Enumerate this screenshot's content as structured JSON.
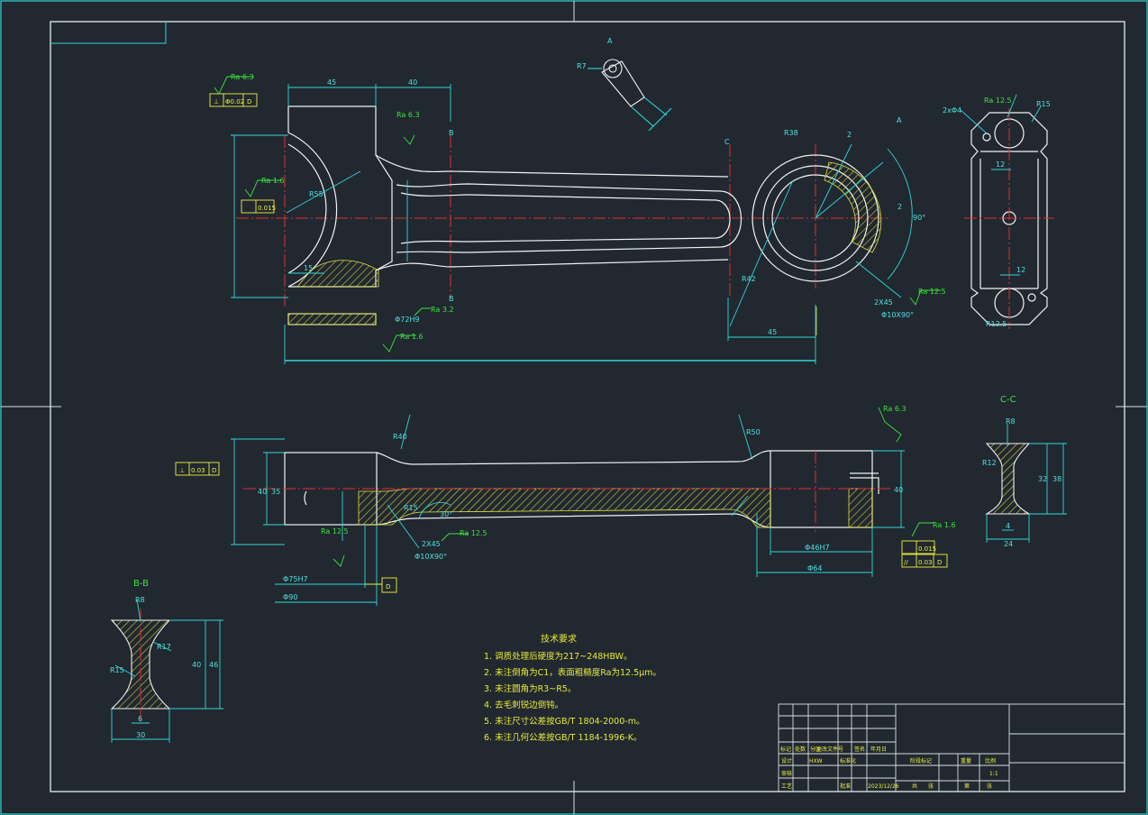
{
  "views": {
    "top_left_label": "A",
    "view_a_label": "A",
    "section_c_mark": "C",
    "section_b_mark": "B",
    "section_bb_title": "B-B",
    "section_cc_title": "C-C"
  },
  "dimensions": {
    "d45_top": "45",
    "d40_top": "40",
    "r55": "R55",
    "d15": "15",
    "phi72": "Φ72H9",
    "d45_right": "45",
    "r42": "R42",
    "r38": "R38",
    "r7": "R7",
    "d2_a": "2",
    "d2_b": "2",
    "angle90": "90°",
    "chamfer_a": "2X45",
    "countersink_a": "Φ10X90°",
    "r12_5": "R12.5",
    "r15": "R15",
    "d12_a": "12",
    "d12_b": "12",
    "hole2x4": "2xΦ4",
    "r40": "R40",
    "r50": "R50",
    "d40_side": "40",
    "d35": "35",
    "d40_right": "40",
    "phi46": "Φ46H7",
    "phi64": "Φ64",
    "phi75": "Φ75H7",
    "phi90": "Φ90",
    "r15_side": "R15",
    "angle30": "30°",
    "chamfer_b": "2X45",
    "countersink_b": "Φ10X90°",
    "b_40": "40",
    "b_46": "46",
    "b_6": "6",
    "b_30": "30",
    "b_r8": "R8",
    "b_r17": "R17",
    "b_r15": "R15",
    "c_32": "32",
    "c_38": "38",
    "c_4": "4",
    "c_24": "24",
    "c_r8": "R8",
    "c_r12": "R12"
  },
  "roughness": {
    "ra63_a": "Ra 6.3",
    "ra63_b": "Ra 6.3",
    "ra16_a": "Ra 1.6",
    "ra32": "Ra 3.2",
    "ra16_b": "Ra 1.6",
    "ra125_a": "Ra 12.5",
    "ra125_b": "Ra 12.5",
    "ra63_c": "Ra 6.3",
    "ra125_c": "Ra 12.5",
    "ra125_d": "Ra 12.5",
    "ra16_c": "Ra 1.6"
  },
  "tolerance_frames": {
    "f1_sym": "⊥",
    "f1_val": "Φ0.02",
    "f1_ref": "D",
    "f2_val": "0.015",
    "f3_sym": "⊥",
    "f3_val": "0.03",
    "f3_ref": "D",
    "f4_val": "0.015",
    "f5_sym": "//",
    "f5_val": "0.03",
    "f5_ref": "D",
    "datum_d": "D"
  },
  "technical_requirements": {
    "title": "技术要求",
    "items": [
      "1. 调质处理后硬度为217~248HBW。",
      "2. 未注倒角为C1，表面粗糙度Ra为12.5μm。",
      "3. 未注圆角为R3~R5。",
      "4. 去毛刺锐边倒钝。",
      "5. 未注尺寸公差按GB/T 1804-2000-m。",
      "6. 未注几何公差按GB/T 1184-1996-K。"
    ]
  },
  "title_block": {
    "r1": [
      "标记",
      "处数",
      "分区",
      "更改文件号",
      "签名",
      "年月日"
    ],
    "r2": [
      "设计",
      "HXW",
      "标准化"
    ],
    "r2b": [
      "阶段标记",
      "重量",
      "比例"
    ],
    "scale": "1:1",
    "r3": [
      "审核"
    ],
    "r4": [
      "工艺",
      "批准",
      "2023/12/26",
      "共",
      "张",
      "第",
      "张"
    ]
  },
  "colors": {
    "background": "#212830",
    "border": "#d8e0e0",
    "geometry": "#f2f2f2",
    "dimension": "#2fd7d7",
    "centerline": "#e03030",
    "hatch": "#e0e040",
    "annotation": "#3fe23f"
  }
}
